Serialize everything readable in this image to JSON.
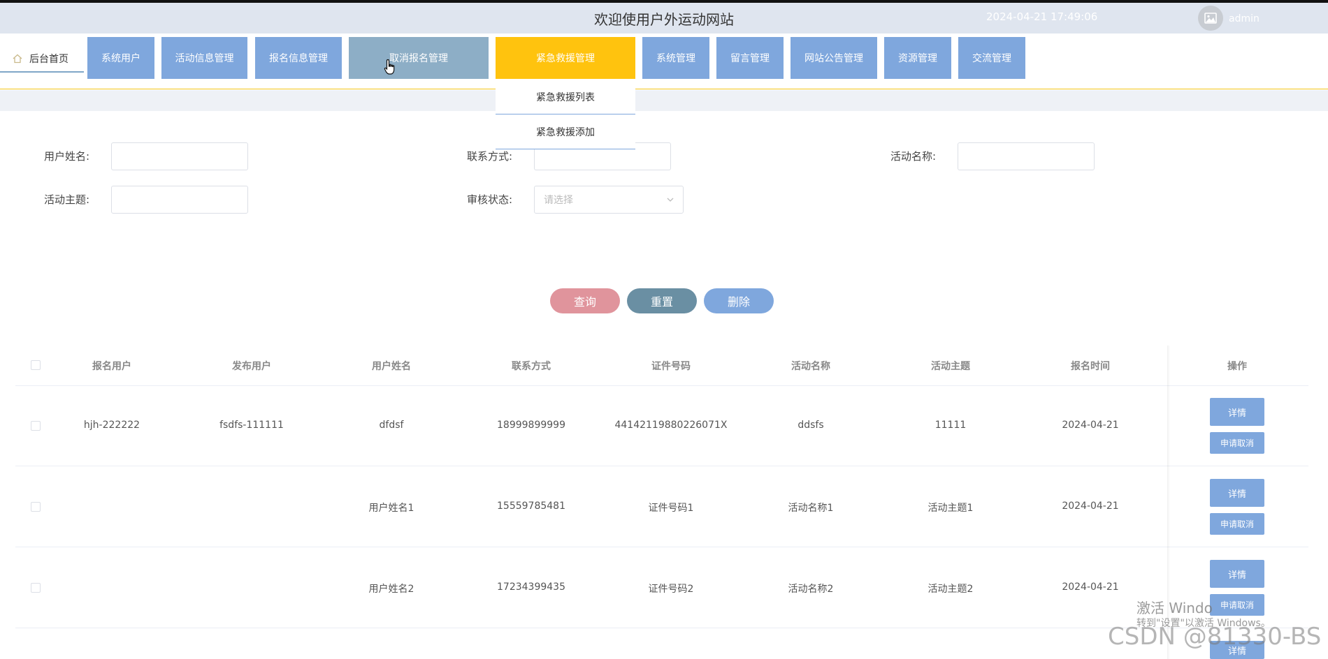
{
  "header": {
    "title": "欢迎使用户外运动网站",
    "datetime": "2024-04-21 17:49:06",
    "username": "admin"
  },
  "nav": {
    "home_label": "后台首页",
    "items": [
      {
        "label": "系统用户"
      },
      {
        "label": "活动信息管理"
      },
      {
        "label": "报名信息管理"
      },
      {
        "label": "取消报名管理"
      },
      {
        "label": "紧急救援管理"
      },
      {
        "label": "系统管理"
      },
      {
        "label": "留言管理"
      },
      {
        "label": "网站公告管理"
      },
      {
        "label": "资源管理"
      },
      {
        "label": "交流管理"
      }
    ],
    "dropdown": [
      {
        "label": "紧急救援列表"
      },
      {
        "label": "紧急救援添加"
      }
    ]
  },
  "filters": {
    "user_name_label": "用户姓名:",
    "contact_label": "联系方式:",
    "activity_name_label": "活动名称:",
    "activity_theme_label": "活动主题:",
    "review_status_label": "审核状态:",
    "review_status_placeholder": "请选择"
  },
  "actions": {
    "query": "查询",
    "reset": "重置",
    "delete": "删除"
  },
  "table": {
    "headers": [
      "报名用户",
      "发布用户",
      "用户姓名",
      "联系方式",
      "证件号码",
      "活动名称",
      "活动主题",
      "报名时间",
      "操作"
    ],
    "rows": [
      {
        "signup_user": "hjh-222222",
        "publisher": "fsdfs-111111",
        "name": "dfdsf",
        "contact": "18999899999",
        "id_no": "44142119880226071X",
        "activity": "ddsfs",
        "theme": "11111",
        "time": "2024-04-21"
      },
      {
        "signup_user": "",
        "publisher": "",
        "name": "用户姓名1",
        "contact": "15559785481",
        "id_no": "证件号码1",
        "activity": "活动名称1",
        "theme": "活动主题1",
        "time": "2024-04-21"
      },
      {
        "signup_user": "",
        "publisher": "",
        "name": "用户姓名2",
        "contact": "17234399435",
        "id_no": "证件号码2",
        "activity": "活动名称2",
        "theme": "活动主题2",
        "time": "2024-04-21"
      }
    ],
    "detail_label": "详情",
    "cancel_label": "申请取消"
  },
  "watermark": {
    "activate_line1": "激活 Windo",
    "activate_line2": "转到\"设置\"以激活 Windows。",
    "csdn": "CSDN @81330-BS"
  },
  "colors": {
    "nav_blue": "#7fa7dd",
    "nav_active": "#ffc30e",
    "query_btn": "#e0949c",
    "reset_btn": "#6a8fa3",
    "delete_btn": "#7fa7dd"
  }
}
